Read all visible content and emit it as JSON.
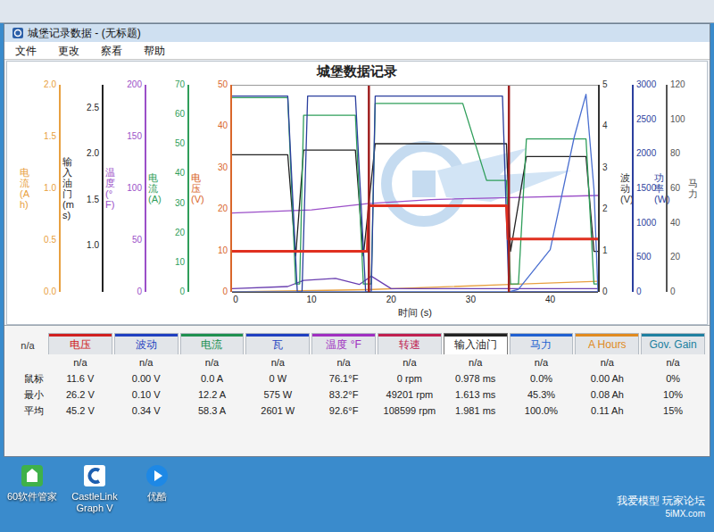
{
  "window": {
    "title": "城堡记录数据 - (无标题)"
  },
  "menu": [
    "文件",
    "更改",
    "察看",
    "帮助"
  ],
  "chart": {
    "title": "城堡数据记录",
    "x_axis": {
      "label": "时间 (s)",
      "min": 0,
      "max": 46,
      "ticks": [
        "0",
        "10",
        "20",
        "30",
        "40"
      ]
    },
    "left_axes": [
      {
        "label": "电流 (Ah)",
        "color": "#e8a040",
        "min": 0,
        "max": 2,
        "ticks": [
          "0.0",
          "0.5",
          "1.0",
          "1.5",
          "2.0"
        ]
      },
      {
        "label": "输入油门 (ms)",
        "color": "#222222",
        "min": 0.5,
        "max": 2.75,
        "ticks": [
          "1.0",
          "1.5",
          "2.0",
          "2.5"
        ]
      },
      {
        "label": "温度 (°F)",
        "color": "#9b4fc8",
        "min": 0,
        "max": 200,
        "ticks": [
          "0",
          "50",
          "100",
          "150",
          "200"
        ]
      },
      {
        "label": "电流 (A)",
        "color": "#2f9e5a",
        "min": 0,
        "max": 70,
        "ticks": [
          "0",
          "10",
          "20",
          "30",
          "40",
          "50",
          "60",
          "70"
        ]
      },
      {
        "label": "电压 (V)",
        "color": "#d9662a",
        "min": 0,
        "max": 50,
        "ticks": [
          "0",
          "10",
          "20",
          "30",
          "40",
          "50"
        ]
      }
    ],
    "right_axes": [
      {
        "label": "波动 (V)",
        "color": "#333333",
        "min": 0,
        "max": 5,
        "ticks": [
          "0",
          "1",
          "2",
          "3",
          "4",
          "5"
        ]
      },
      {
        "label": "功率 (W)",
        "color": "#2b3f9e",
        "min": 0,
        "max": 3000,
        "ticks": [
          "0",
          "500",
          "1000",
          "1500",
          "2000",
          "2500",
          "3000"
        ]
      },
      {
        "label": "马力",
        "color": "#555555",
        "min": 0,
        "max": 120,
        "ticks": [
          "0",
          "20",
          "40",
          "60",
          "80",
          "100",
          "120"
        ]
      }
    ],
    "series": [
      {
        "name": "电流 (Ah)",
        "axis": "left_axes.0",
        "color": "#e8a040",
        "points": [
          [
            0,
            0.0
          ],
          [
            17,
            0.03
          ],
          [
            35,
            0.08
          ],
          [
            46,
            0.11
          ]
        ]
      },
      {
        "name": "温度",
        "axis": "left_axes.2",
        "color": "#9b4fc8",
        "points": [
          [
            0,
            77
          ],
          [
            10,
            80
          ],
          [
            17,
            86
          ],
          [
            25,
            90
          ],
          [
            35,
            92
          ],
          [
            46,
            94
          ]
        ]
      },
      {
        "name": "波动",
        "axis": "right_axes.0",
        "color": "#6a3fb0",
        "points": [
          [
            0,
            0.1
          ],
          [
            7,
            0.15
          ],
          [
            9,
            0.3
          ],
          [
            13,
            0.35
          ],
          [
            16,
            0.2
          ],
          [
            17.5,
            0.4
          ],
          [
            20,
            0.1
          ],
          [
            46,
            0.1
          ]
        ]
      },
      {
        "name": "输入油门",
        "axis": "left_axes.1",
        "color": "#222222",
        "points": [
          [
            0,
            2.0
          ],
          [
            7,
            2.0
          ],
          [
            8,
            0.9
          ],
          [
            9,
            2.05
          ],
          [
            15.5,
            2.05
          ],
          [
            16.5,
            0.9
          ],
          [
            18,
            2.12
          ],
          [
            34.5,
            2.12
          ],
          [
            35,
            0.95
          ],
          [
            37,
            1.98
          ],
          [
            44.5,
            1.98
          ],
          [
            45.5,
            0.95
          ],
          [
            46,
            0.95
          ]
        ]
      },
      {
        "name": "电流",
        "axis": "left_axes.3",
        "color": "#2f9e5a",
        "points": [
          [
            0,
            66
          ],
          [
            7,
            66
          ],
          [
            8,
            3
          ],
          [
            8.5,
            3
          ],
          [
            9,
            60
          ],
          [
            15.5,
            60
          ],
          [
            16.5,
            3
          ],
          [
            17.5,
            3
          ],
          [
            18,
            64
          ],
          [
            29,
            64
          ],
          [
            32,
            38
          ],
          [
            34.5,
            38
          ],
          [
            35,
            3
          ],
          [
            36,
            3
          ],
          [
            37,
            52
          ],
          [
            44.5,
            52
          ],
          [
            45.5,
            3
          ],
          [
            46,
            3
          ]
        ]
      },
      {
        "name": "功率",
        "axis": "right_axes.1",
        "color": "#2b3f9e",
        "points": [
          [
            0,
            2850
          ],
          [
            7,
            2850
          ],
          [
            8.2,
            0
          ],
          [
            8.8,
            0
          ],
          [
            9.5,
            2850
          ],
          [
            15.5,
            2850
          ],
          [
            16.8,
            0
          ],
          [
            17.5,
            0
          ],
          [
            18,
            2850
          ],
          [
            34,
            2850
          ],
          [
            34.8,
            0
          ],
          [
            46,
            0
          ]
        ]
      },
      {
        "name": "马力",
        "axis": "right_axes.2",
        "color": "#4a6fd0",
        "points": [
          [
            0,
            0
          ],
          [
            34.8,
            0
          ],
          [
            36,
            2
          ],
          [
            40,
            25
          ],
          [
            43,
            90
          ],
          [
            44.5,
            115
          ],
          [
            45.5,
            60
          ],
          [
            46,
            0
          ]
        ]
      },
      {
        "name": "电压",
        "axis": "left_axes.4",
        "color": "#e03020",
        "points": [
          [
            0,
            10
          ],
          [
            17,
            10
          ],
          [
            17.2,
            21
          ],
          [
            34.5,
            21
          ],
          [
            34.7,
            13
          ],
          [
            46,
            13
          ]
        ]
      }
    ],
    "markers": [
      {
        "time": 17.2,
        "color": "#a02020"
      },
      {
        "time": 34.8,
        "color": "#a02020"
      }
    ]
  },
  "stats": {
    "corner": "n/a",
    "columns": [
      {
        "label": "电压",
        "color": "#d02020",
        "selected": false
      },
      {
        "label": "波动",
        "color": "#2040c0",
        "selected": false
      },
      {
        "label": "电流",
        "color": "#209050",
        "selected": false
      },
      {
        "label": "瓦",
        "color": "#2040c0",
        "selected": false
      },
      {
        "label": "温度 °F",
        "color": "#a030c0",
        "selected": false
      },
      {
        "label": "转速",
        "color": "#c02050",
        "selected": false
      },
      {
        "label": "输入油门",
        "color": "#222222",
        "selected": true
      },
      {
        "label": "马力",
        "color": "#2060d0",
        "selected": false
      },
      {
        "label": "A Hours",
        "color": "#e08a20",
        "selected": false
      },
      {
        "label": "Gov. Gain",
        "color": "#2080a0",
        "selected": false
      }
    ],
    "rows": [
      {
        "label": "",
        "values": [
          "n/a",
          "n/a",
          "n/a",
          "n/a",
          "n/a",
          "n/a",
          "n/a",
          "n/a",
          "n/a",
          "n/a"
        ]
      },
      {
        "label": "鼠标",
        "values": [
          "11.6 V",
          "0.00 V",
          "0.0 A",
          "0 W",
          "76.1°F",
          "0 rpm",
          "0.978 ms",
          "0.0%",
          "0.00 Ah",
          "0%"
        ]
      },
      {
        "label": "最小",
        "values": [
          "26.2 V",
          "0.10 V",
          "12.2 A",
          "575 W",
          "83.2°F",
          "49201 rpm",
          "1.613 ms",
          "45.3%",
          "0.08 Ah",
          "10%"
        ]
      },
      {
        "label": "平均",
        "values": [
          "45.2 V",
          "0.34 V",
          "58.3 A",
          "2601 W",
          "92.6°F",
          "108599 rpm",
          "1.981 ms",
          "100.0%",
          "0.11 Ah",
          "15%"
        ]
      }
    ]
  },
  "desktop": {
    "icons": [
      {
        "label": "60软件管家"
      },
      {
        "label": "CastleLink Graph V"
      },
      {
        "label": "优酷"
      }
    ],
    "watermark": [
      "我爱模型 玩家论坛",
      "5iMX.com"
    ]
  }
}
